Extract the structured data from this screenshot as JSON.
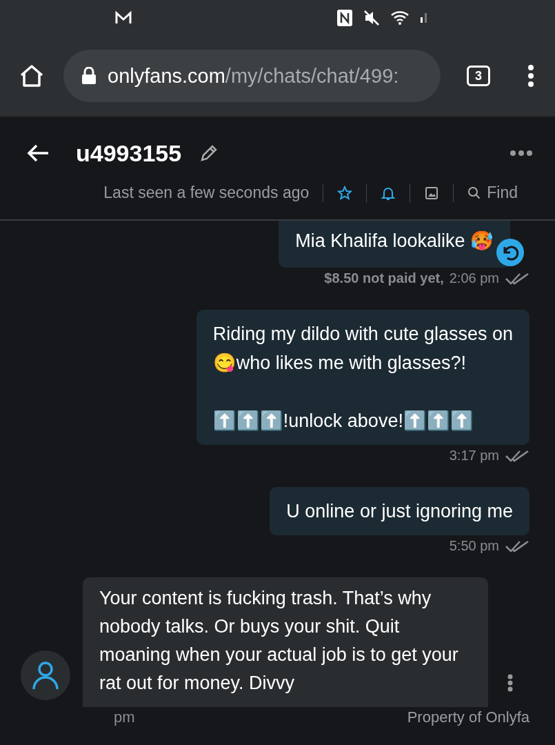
{
  "browser": {
    "url_host": "onlyfans.com",
    "url_path": "/my/chats/chat/499:",
    "tab_count": "3"
  },
  "chat": {
    "username": "u4993155",
    "last_seen": "Last seen a few seconds ago",
    "find_label": "Find"
  },
  "messages": [
    {
      "kind": "sent",
      "text": "Mia Khalifa lookalike 🥵",
      "price": "$8.50 not paid yet,",
      "time": "2:06 pm",
      "reply_icon": true
    },
    {
      "kind": "sent",
      "text": "Riding my dildo with cute glasses on\n😋who likes me with glasses?!\n\n⬆️⬆️⬆️!unlock above!⬆️⬆️⬆️",
      "time": "3:17 pm",
      "reply_icon": false
    },
    {
      "kind": "sent",
      "text": "U online or just ignoring me",
      "time": "5:50 pm",
      "reply_icon": false
    },
    {
      "kind": "received",
      "text": "Your content is fucking trash. That’s why nobody talks. Or buys your shit. Quit moaning when your actual job is to get your rat out for money. Divvy",
      "time": "pm",
      "reply_icon": false
    }
  ],
  "footer": {
    "notice": "Property of Onlyfa"
  }
}
